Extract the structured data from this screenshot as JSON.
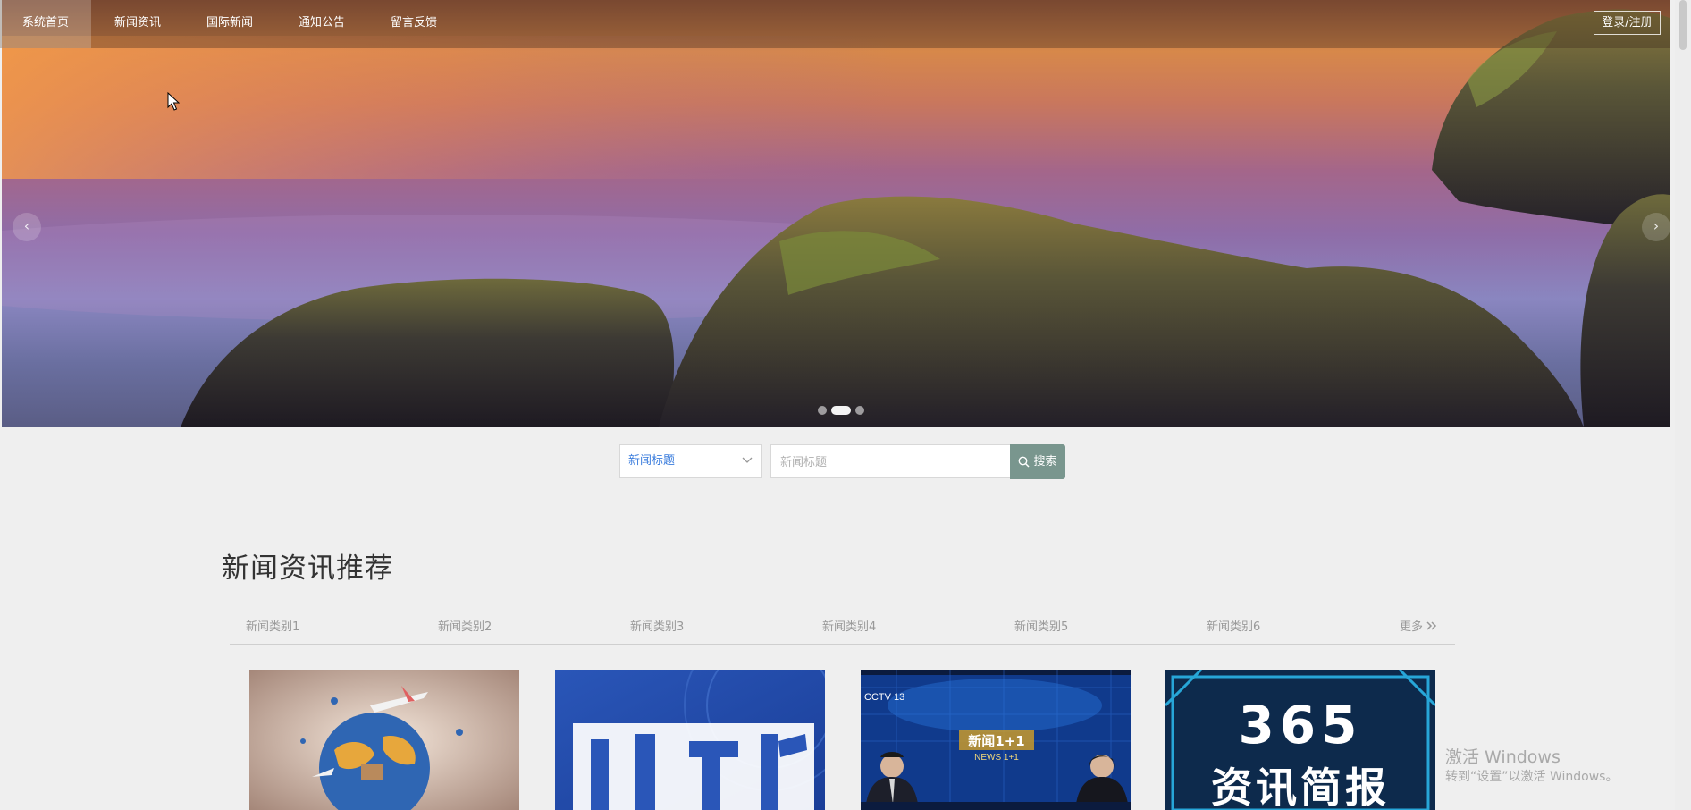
{
  "nav": {
    "items": [
      {
        "label": "系统首页",
        "active": true
      },
      {
        "label": "新闻资讯",
        "active": false
      },
      {
        "label": "国际新闻",
        "active": false
      },
      {
        "label": "通知公告",
        "active": false
      },
      {
        "label": "留言反馈",
        "active": false
      }
    ],
    "login_label": "登录/注册"
  },
  "carousel": {
    "prev_icon": "‹",
    "next_icon": "›",
    "slide_count": 3,
    "active_slide": 2
  },
  "search": {
    "select_value": "新闻标题",
    "input_placeholder": "新闻标题",
    "input_value": "",
    "button_label": "搜索"
  },
  "section": {
    "title": "新闻资讯推荐",
    "categories": [
      "新闻类别1",
      "新闻类别2",
      "新闻类别3",
      "新闻类别4",
      "新闻类别5",
      "新闻类别6"
    ],
    "more_label": "更多",
    "cards": [
      {
        "image": "travel-globe-airplanes"
      },
      {
        "image": "blue-banner-shizheng"
      },
      {
        "image": "cctv-news-1plus1-anchors",
        "logo_text": "CCTV 13",
        "caption": "新闻1+1",
        "caption_sub": "NEWS 1+1"
      },
      {
        "image": "365-news-brief",
        "line1": "365",
        "line2": "资讯简报"
      }
    ]
  },
  "watermark": {
    "line1": "激活 Windows",
    "line2": "转到“设置”以激活 Windows。"
  },
  "colors": {
    "accent_blue": "#3b7ddd",
    "search_button": "#79968e",
    "page_background": "#efefef"
  }
}
